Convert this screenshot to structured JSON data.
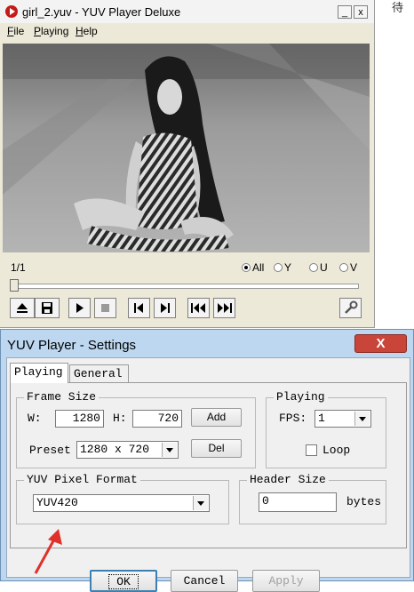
{
  "player": {
    "title": "girl_2.yuv - YUV Player Deluxe",
    "minimize_label": "_",
    "close_label": "x",
    "menu": [
      {
        "accel": "F",
        "rest": "ile"
      },
      {
        "accel": "P",
        "rest": "laying"
      },
      {
        "accel": "H",
        "rest": "elp"
      }
    ],
    "frame_counter": "1/1",
    "channels": [
      {
        "label": "All",
        "selected": true
      },
      {
        "label": "Y",
        "selected": false
      },
      {
        "label": "U",
        "selected": false
      },
      {
        "label": "V",
        "selected": false
      }
    ],
    "seek_position": 0,
    "controls": [
      "eject-icon",
      "save-icon",
      "play-icon",
      "stop-icon",
      "step-back-icon",
      "step-forward-icon",
      "skip-start-icon",
      "skip-end-icon",
      "settings-wrench-icon"
    ]
  },
  "settings": {
    "title": "YUV Player - Settings",
    "close_label": "X",
    "tabs": [
      "Playing",
      "General"
    ],
    "frame_size": {
      "label": "Frame Size",
      "w_label": "W:",
      "w_value": "1280",
      "h_label": "H:",
      "h_value": "720",
      "add_label": "Add",
      "preset_label": "Preset",
      "preset_value": "1280 x 720",
      "del_label": "Del"
    },
    "playing": {
      "label": "Playing",
      "fps_label": "FPS:",
      "fps_value": "1",
      "loop_label": "Loop"
    },
    "pixel_format": {
      "label": "YUV Pixel Format",
      "value": "YUV420"
    },
    "header_size": {
      "label": "Header Size",
      "value": "0",
      "unit": "bytes"
    },
    "buttons": {
      "ok": "OK",
      "cancel": "Cancel",
      "apply": "Apply"
    }
  },
  "background_text": "待",
  "colors": {
    "annotation_arrow": "#e0302a",
    "close_button": "#c9453a",
    "dialog_frame": "#bcd7ef"
  }
}
